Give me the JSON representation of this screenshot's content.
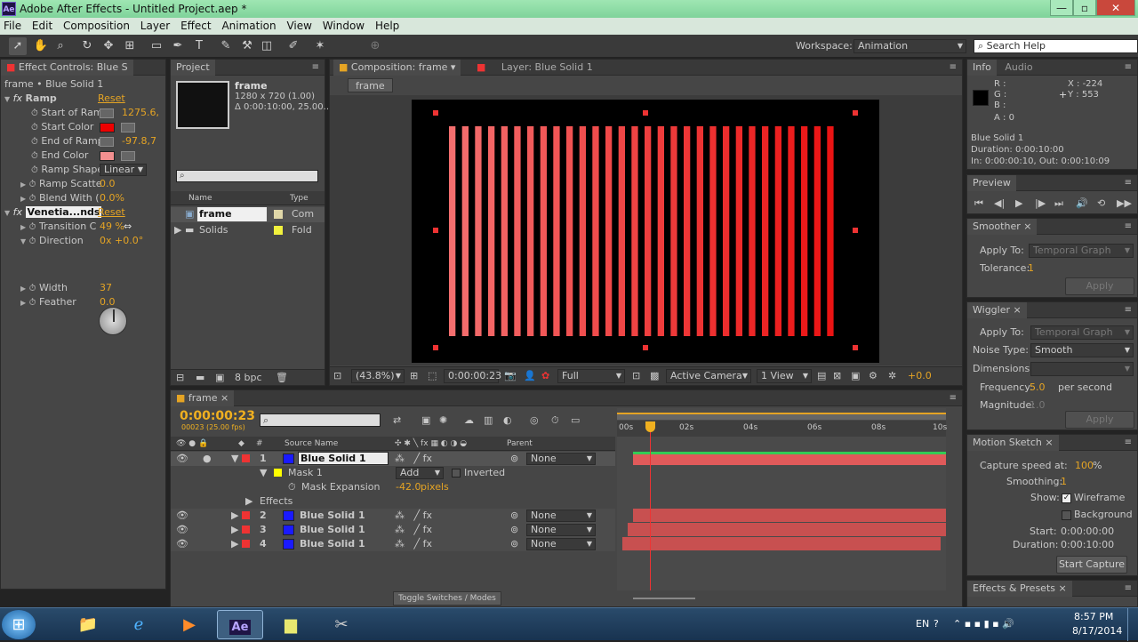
{
  "window": {
    "title": "Adobe After Effects - Untitled Project.aep *",
    "app_icon": "Ae",
    "min": "—",
    "max": "▫",
    "close": "✕"
  },
  "menu": [
    "File",
    "Edit",
    "Composition",
    "Layer",
    "Effect",
    "Animation",
    "View",
    "Window",
    "Help"
  ],
  "workspace": {
    "label": "Workspace:",
    "value": "Animation",
    "search_placeholder": "Search Help"
  },
  "effect_controls": {
    "tab": "Effect Controls: Blue S",
    "subtitle": "frame • Blue Solid 1",
    "ramp": {
      "name": "Ramp",
      "reset": "Reset",
      "rows": [
        {
          "label": "Start of Ram",
          "value": "1275.6,"
        },
        {
          "label": "Start Color",
          "color": "#ee0000"
        },
        {
          "label": "End of Ramp",
          "value": "-97.8,7"
        },
        {
          "label": "End Color",
          "color": "#f39090"
        },
        {
          "label": "Ramp Shape",
          "dropdown": "Linear"
        },
        {
          "label": "Ramp Scatte",
          "value": "0.0"
        },
        {
          "label": "Blend With (",
          "value": "0.0%"
        }
      ]
    },
    "venetian": {
      "name": "Venetia...nds",
      "reset": "Reset",
      "rows": [
        {
          "label": "Transition C",
          "value": "49 %"
        },
        {
          "label": "Direction",
          "value": "0x +0.0°"
        },
        {
          "label": "Width",
          "value": "37"
        },
        {
          "label": "Feather",
          "value": "0.0"
        }
      ]
    }
  },
  "project": {
    "tab": "Project",
    "item_name": "frame",
    "item_info1": "1280 x 720 (1.00)",
    "item_info2": "Δ 0:00:10:00, 25.00...",
    "search_placeholder": "",
    "col_name": "Name",
    "col_type": "Type",
    "items": [
      {
        "name": "frame",
        "type": "Com",
        "color": "#e0d7a8"
      },
      {
        "name": "Solids",
        "type": "Fold",
        "color": "#f1f13d"
      }
    ],
    "bpc": "8 bpc"
  },
  "composition": {
    "tab": "Composition: frame",
    "layer_tab": "Layer: Blue Solid 1",
    "crumb": "frame",
    "zoom": "(43.8%)",
    "timecode": "0:00:00:23",
    "resolution": "Full",
    "camera": "Active Camera",
    "views": "1 View",
    "exposure": "+0.0",
    "stripes": 30
  },
  "info": {
    "tab": "Info",
    "tab2": "Audio",
    "r": "R :",
    "g": "G :",
    "b": "B :",
    "a": "A : 0",
    "x": "X : -224",
    "y": "Y : 553",
    "layer": "Blue Solid 1",
    "duration": "Duration: 0:00:10:00",
    "inout": "In: 0:00:00:10, Out: 0:00:10:09"
  },
  "preview": {
    "tab": "Preview"
  },
  "smoother": {
    "tab": "Smoother",
    "apply_label": "Apply To:",
    "apply_value": "Temporal Graph",
    "tol_label": "Tolerance:",
    "tol_value": "1",
    "apply_btn": "Apply"
  },
  "wiggler": {
    "tab": "Wiggler",
    "apply_label": "Apply To:",
    "apply_value": "Temporal Graph",
    "noise_label": "Noise Type:",
    "noise_value": "Smooth",
    "dim_label": "Dimensions:",
    "freq_label": "Frequency:",
    "freq_value": "5.0",
    "freq_unit": "per second",
    "mag_label": "Magnitude:",
    "mag_value": "1.0",
    "apply_btn": "Apply"
  },
  "motion_sketch": {
    "tab": "Motion Sketch",
    "speed_label": "Capture speed at:",
    "speed_value": "100",
    "speed_unit": "%",
    "smooth_label": "Smoothing:",
    "smooth_value": "1",
    "show_label": "Show:",
    "wire": "Wireframe",
    "bg": "Background",
    "start_label": "Start:",
    "start_value": "0:00:00:00",
    "dur_label": "Duration:",
    "dur_value": "0:00:10:00",
    "btn": "Start Capture"
  },
  "effects_presets": {
    "tab": "Effects & Presets"
  },
  "timeline": {
    "tab": "frame",
    "timecode": "0:00:00:23",
    "fps": "00023 (25.00 fps)",
    "col_source": "Source Name",
    "col_parent": "Parent",
    "ruler": [
      "00s",
      "02s",
      "04s",
      "06s",
      "08s",
      "10s"
    ],
    "layers": [
      {
        "num": "1",
        "name": "Blue Solid 1",
        "parent": "None",
        "selected": true
      },
      {
        "num": "2",
        "name": "Blue Solid 1",
        "parent": "None"
      },
      {
        "num": "3",
        "name": "Blue Solid 1",
        "parent": "None"
      },
      {
        "num": "4",
        "name": "Blue Solid 1",
        "parent": "None"
      }
    ],
    "mask": "Mask 1",
    "mask_mode": "Add",
    "inverted": "Inverted",
    "mask_exp": "Mask Expansion",
    "mask_exp_val": "-42.0",
    "mask_exp_unit": "pixels",
    "effects": "Effects",
    "toggle": "Toggle Switches / Modes"
  },
  "taskbar": {
    "lang": "EN",
    "time": "8:57 PM",
    "date": "8/17/2014"
  }
}
